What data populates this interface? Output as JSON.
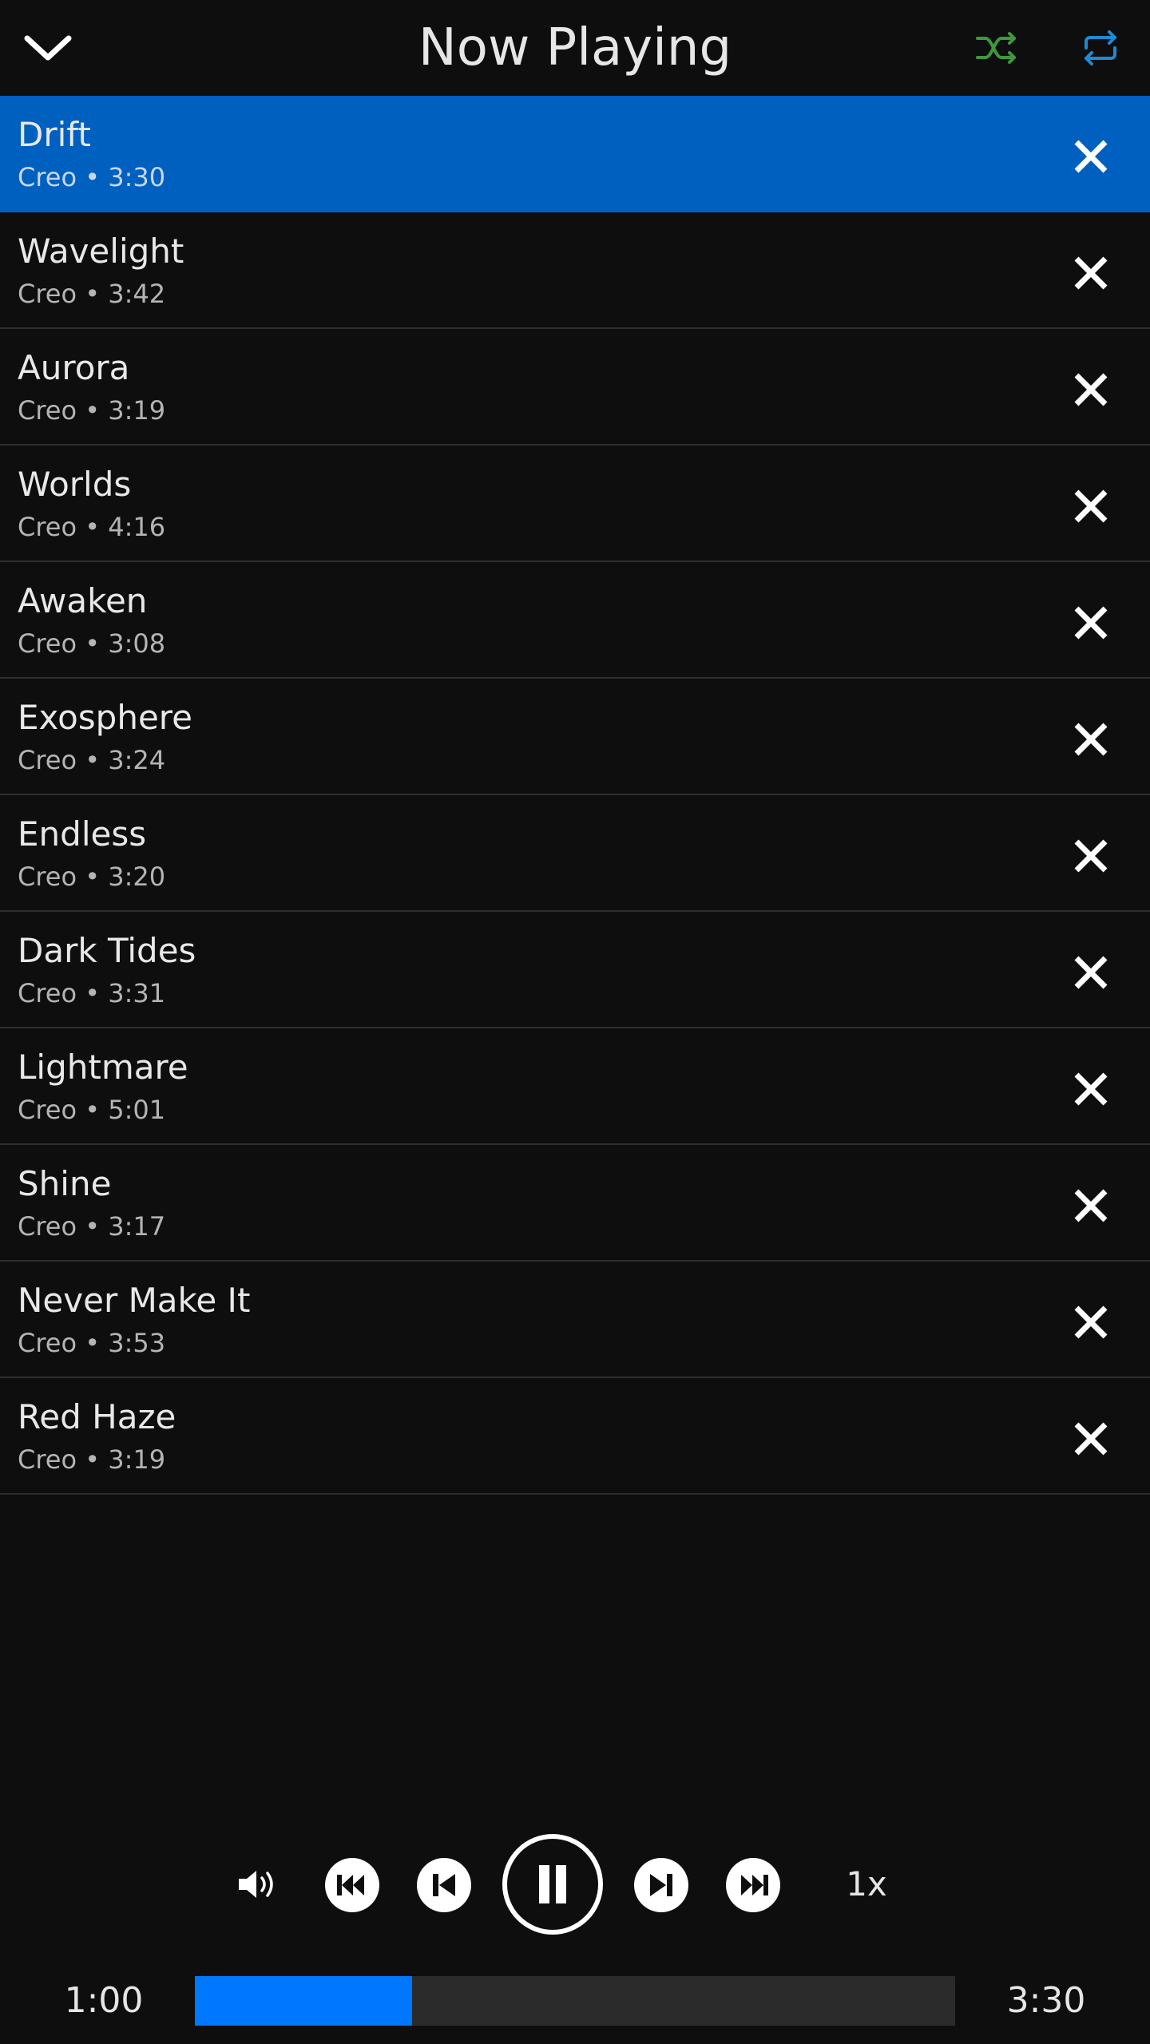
{
  "header": {
    "title": "Now Playing",
    "collapse_icon": "chevron-down-icon",
    "shuffle_icon": "shuffle-icon",
    "repeat_icon": "repeat-icon",
    "shuffle_color": "#3c9a3c",
    "repeat_color": "#1e8ad6"
  },
  "queue": {
    "active_index": 0,
    "active_color": "#0060c0",
    "remove_icon": "close-icon",
    "tracks": [
      {
        "title": "Drift",
        "meta": "Creo • 3:30"
      },
      {
        "title": "Wavelight",
        "meta": "Creo • 3:42"
      },
      {
        "title": "Aurora",
        "meta": "Creo • 3:19"
      },
      {
        "title": "Worlds",
        "meta": "Creo • 4:16"
      },
      {
        "title": "Awaken",
        "meta": "Creo • 3:08"
      },
      {
        "title": "Exosphere",
        "meta": "Creo • 3:24"
      },
      {
        "title": "Endless",
        "meta": "Creo • 3:20"
      },
      {
        "title": "Dark Tides",
        "meta": "Creo • 3:31"
      },
      {
        "title": "Lightmare",
        "meta": "Creo • 5:01"
      },
      {
        "title": "Shine",
        "meta": "Creo • 3:17"
      },
      {
        "title": "Never Make It",
        "meta": "Creo • 3:53"
      },
      {
        "title": "Red Haze",
        "meta": "Creo • 3:19"
      }
    ]
  },
  "controls": {
    "volume_icon": "volume-icon",
    "rewind_icon": "rewind-icon",
    "previous_icon": "skip-previous-icon",
    "pause_icon": "pause-icon",
    "next_icon": "skip-next-icon",
    "fast_forward_icon": "fast-forward-icon",
    "speed": "1x"
  },
  "progress": {
    "current_time": "1:00",
    "total_time": "3:30",
    "fraction": 0.2857,
    "fill_color": "#0077ff"
  }
}
